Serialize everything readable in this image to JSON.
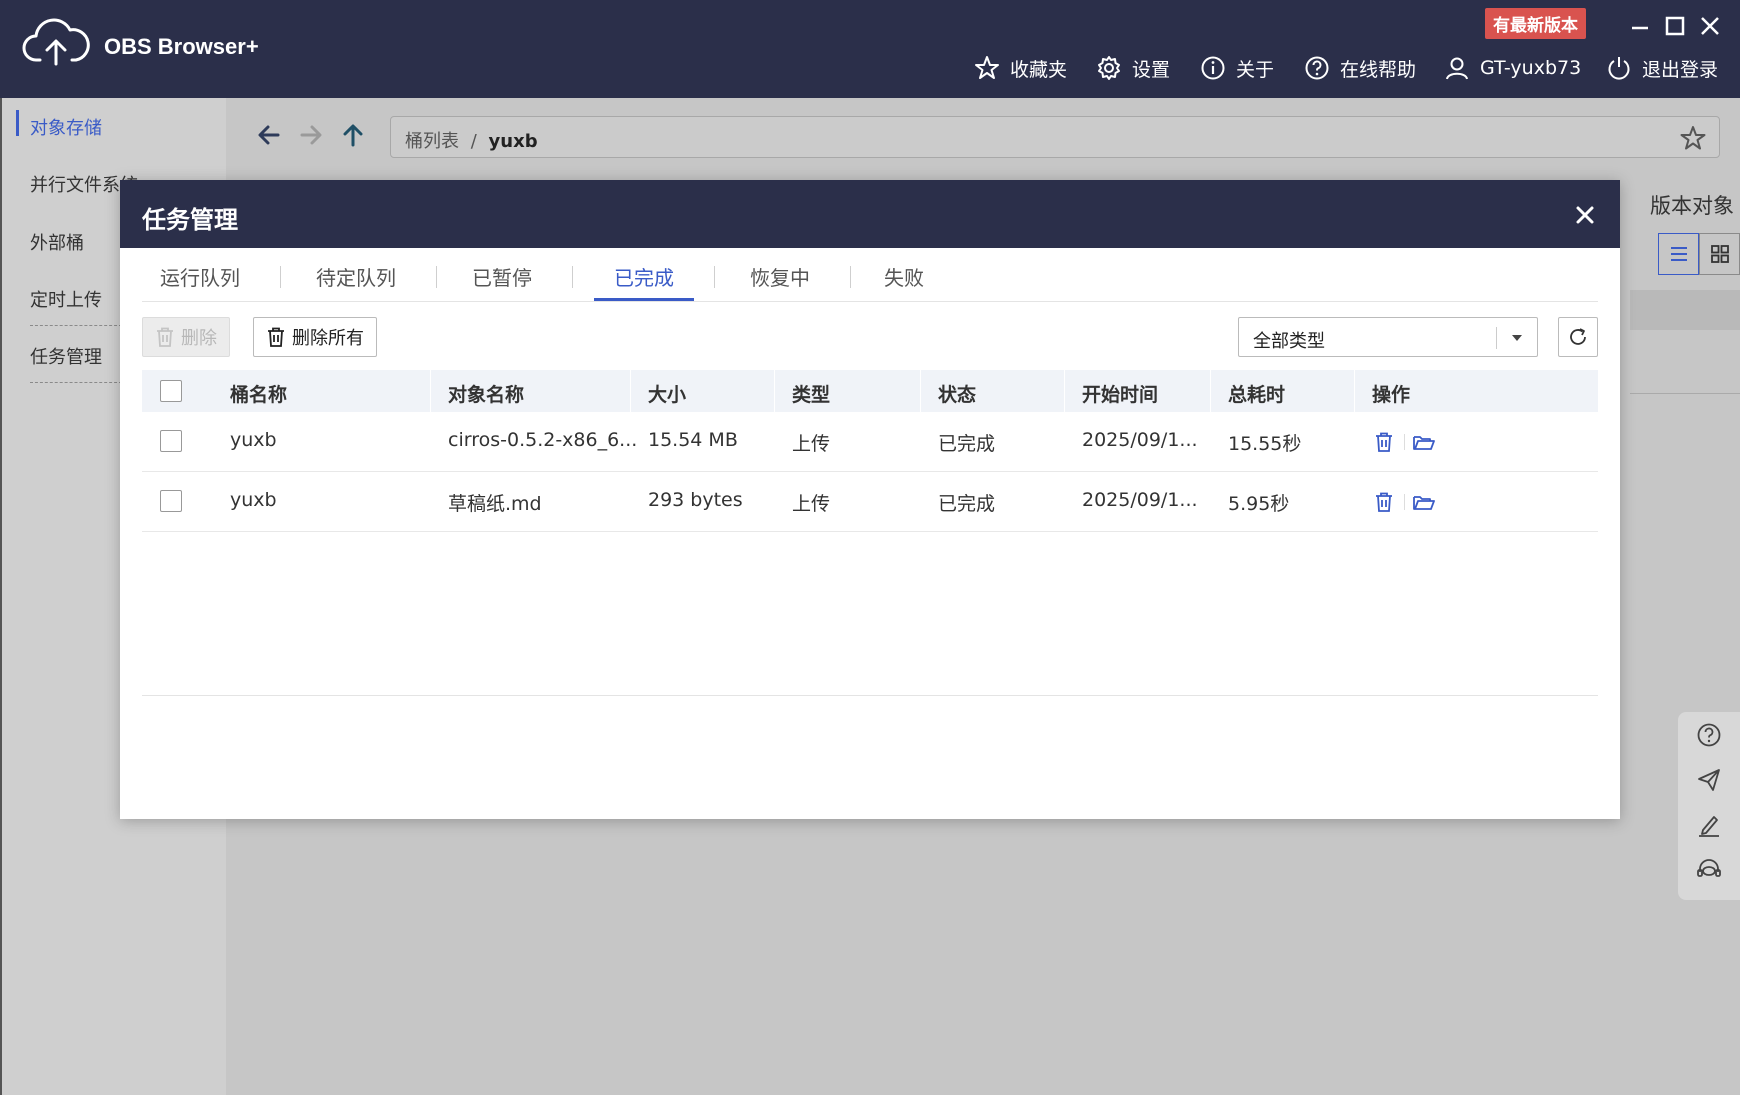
{
  "app": {
    "title": "OBS Browser+",
    "update_badge": "有最新版本"
  },
  "menu": {
    "favorites": "收藏夹",
    "settings": "设置",
    "about": "关于",
    "online_help": "在线帮助",
    "user": "GT-yuxb73",
    "logout": "退出登录"
  },
  "sidebar": {
    "items": [
      {
        "label": "对象存储",
        "active": true
      },
      {
        "label": "并行文件系统"
      },
      {
        "label": "外部桶"
      },
      {
        "label": "定时上传"
      },
      {
        "label": "任务管理"
      }
    ]
  },
  "path": {
    "root": "桶列表",
    "separator": "/",
    "current": "yuxb"
  },
  "background": {
    "version_objects": "版本对象"
  },
  "modal": {
    "title": "任务管理",
    "tabs": [
      {
        "label": "运行队列"
      },
      {
        "label": "待定队列"
      },
      {
        "label": "已暂停"
      },
      {
        "label": "已完成",
        "active": true
      },
      {
        "label": "恢复中"
      },
      {
        "label": "失败"
      }
    ],
    "delete_label": "删除",
    "delete_all_label": "删除所有",
    "type_filter": "全部类型",
    "columns": [
      "桶名称",
      "对象名称",
      "大小",
      "类型",
      "状态",
      "开始时间",
      "总耗时",
      "操作"
    ],
    "rows": [
      {
        "bucket": "yuxb",
        "object": "cirros-0.5.2-x86_6...",
        "size": "15.54 MB",
        "type": "上传",
        "status": "已完成",
        "start": "2025/09/1...",
        "duration": "15.55秒"
      },
      {
        "bucket": "yuxb",
        "object": "草稿纸.md",
        "size": "293 bytes",
        "type": "上传",
        "status": "已完成",
        "start": "2025/09/1...",
        "duration": "5.95秒"
      }
    ]
  },
  "colors": {
    "header_bg": "#2b2f4a",
    "accent": "#3a5bc7",
    "badge": "#d9534f"
  }
}
